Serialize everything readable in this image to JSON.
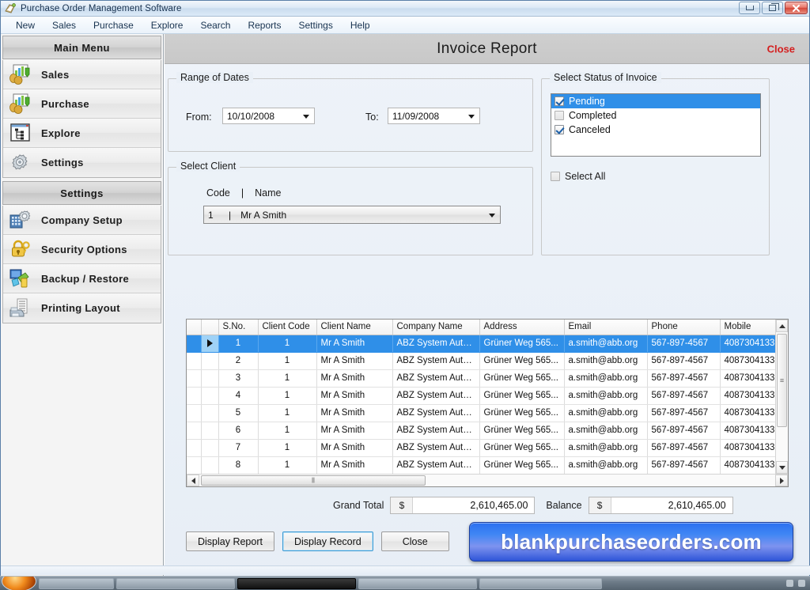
{
  "window": {
    "title": "Purchase Order Management Software",
    "app_icon": "application-icon",
    "minimize_label": "Minimize",
    "maximize_label": "Restore",
    "close_label": "Close"
  },
  "menubar": {
    "items": [
      {
        "label": "New"
      },
      {
        "label": "Sales"
      },
      {
        "label": "Purchase"
      },
      {
        "label": "Explore"
      },
      {
        "label": "Search"
      },
      {
        "label": "Reports"
      },
      {
        "label": "Settings"
      },
      {
        "label": "Help"
      }
    ]
  },
  "sidebar": {
    "main_menu_header": "Main Menu",
    "main_items": [
      {
        "label": "Sales",
        "icon": "sales-chart-icon"
      },
      {
        "label": "Purchase",
        "icon": "purchase-chart-icon"
      },
      {
        "label": "Explore",
        "icon": "explore-tree-icon"
      },
      {
        "label": "Settings",
        "icon": "gear-icon"
      }
    ],
    "settings_header": "Settings",
    "settings_items": [
      {
        "label": "Company Setup",
        "icon": "company-gear-icon"
      },
      {
        "label": "Security Options",
        "icon": "lock-key-icon"
      },
      {
        "label": "Backup / Restore",
        "icon": "backup-restore-icon"
      },
      {
        "label": "Printing Layout",
        "icon": "printer-icon"
      }
    ]
  },
  "form": {
    "title": "Invoice Report",
    "close_label": "Close"
  },
  "range_of_dates": {
    "legend": "Range of Dates",
    "from_label": "From:",
    "from_value": "10/10/2008",
    "to_label": "To:",
    "to_value": "11/09/2008"
  },
  "select_client": {
    "legend": "Select Client",
    "code_header": "Code",
    "separator": "|",
    "name_header": "Name",
    "selected_code": "1",
    "selected_name": "Mr A Smith"
  },
  "status": {
    "legend": "Select Status of Invoice",
    "options": [
      {
        "label": "Pending",
        "checked": true,
        "selected": true
      },
      {
        "label": "Completed",
        "checked": false,
        "selected": false
      },
      {
        "label": "Canceled",
        "checked": true,
        "selected": false
      }
    ],
    "select_all_label": "Select All",
    "select_all_checked": false
  },
  "grid": {
    "columns": [
      "S.No.",
      "Client Code",
      "Client Name",
      "Company Name",
      "Address",
      "Email",
      "Phone",
      "Mobile"
    ],
    "rows": [
      {
        "sno": "1",
        "client_code": "1",
        "client_name": "Mr A Smith",
        "company_name": "ABZ System Autom...",
        "address": "Grüner Weg 565...",
        "email": "a.smith@abb.org",
        "phone": "567-897-4567",
        "mobile": "4087304133",
        "selected": true
      },
      {
        "sno": "2",
        "client_code": "1",
        "client_name": "Mr A Smith",
        "company_name": "ABZ System Autom...",
        "address": "Grüner Weg 565...",
        "email": "a.smith@abb.org",
        "phone": "567-897-4567",
        "mobile": "4087304133",
        "selected": false
      },
      {
        "sno": "3",
        "client_code": "1",
        "client_name": "Mr A Smith",
        "company_name": "ABZ System Autom...",
        "address": "Grüner Weg 565...",
        "email": "a.smith@abb.org",
        "phone": "567-897-4567",
        "mobile": "4087304133",
        "selected": false
      },
      {
        "sno": "4",
        "client_code": "1",
        "client_name": "Mr A Smith",
        "company_name": "ABZ System Autom...",
        "address": "Grüner Weg 565...",
        "email": "a.smith@abb.org",
        "phone": "567-897-4567",
        "mobile": "4087304133",
        "selected": false
      },
      {
        "sno": "5",
        "client_code": "1",
        "client_name": "Mr A Smith",
        "company_name": "ABZ System Autom...",
        "address": "Grüner Weg 565...",
        "email": "a.smith@abb.org",
        "phone": "567-897-4567",
        "mobile": "4087304133",
        "selected": false
      },
      {
        "sno": "6",
        "client_code": "1",
        "client_name": "Mr A Smith",
        "company_name": "ABZ System Autom...",
        "address": "Grüner Weg 565...",
        "email": "a.smith@abb.org",
        "phone": "567-897-4567",
        "mobile": "4087304133",
        "selected": false
      },
      {
        "sno": "7",
        "client_code": "1",
        "client_name": "Mr A Smith",
        "company_name": "ABZ System Autom...",
        "address": "Grüner Weg 565...",
        "email": "a.smith@abb.org",
        "phone": "567-897-4567",
        "mobile": "4087304133",
        "selected": false
      },
      {
        "sno": "8",
        "client_code": "1",
        "client_name": "Mr A Smith",
        "company_name": "ABZ System Autom...",
        "address": "Grüner Weg 565...",
        "email": "a.smith@abb.org",
        "phone": "567-897-4567",
        "mobile": "4087304133",
        "selected": false
      }
    ]
  },
  "totals": {
    "grand_total_label": "Grand Total",
    "grand_total_currency": "$",
    "grand_total_value": "2,610,465.00",
    "balance_label": "Balance",
    "balance_currency": "$",
    "balance_value": "2,610,465.00"
  },
  "buttons": {
    "display_report": "Display Report",
    "display_record": "Display Record",
    "close": "Close"
  },
  "banner": {
    "text": "blankpurchaseorders.com"
  },
  "colors": {
    "selection_blue": "#2f8fe8",
    "close_red": "#d41f1f",
    "banner_blue": "#3f86f4",
    "titlebar_blue": "#dce9f6"
  }
}
